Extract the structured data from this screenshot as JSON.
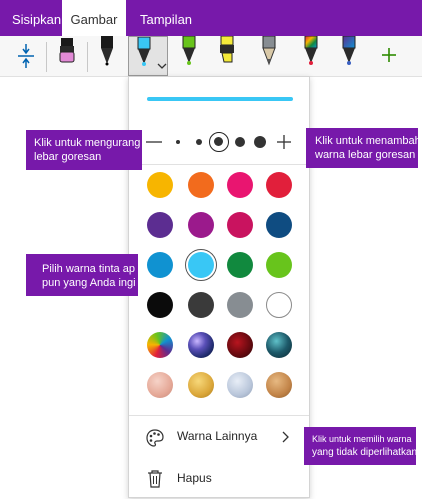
{
  "ribbon": {
    "tabs": [
      {
        "label": "Sisipkan"
      },
      {
        "label": "Gambar"
      },
      {
        "label": "Tampilan"
      }
    ],
    "active_tab": "Gambar"
  },
  "toolbar": {
    "tools": [
      {
        "name": "lasso-space-icon"
      },
      {
        "name": "highlighter-pink-icon"
      },
      {
        "name": "pen-black-icon"
      },
      {
        "name": "pen-cyan-icon",
        "selected": true
      },
      {
        "name": "pen-green-icon"
      },
      {
        "name": "highlighter-yellow-icon"
      },
      {
        "name": "pencil-gray-icon"
      },
      {
        "name": "pen-rainbow-icon"
      },
      {
        "name": "pen-galaxy-icon"
      },
      {
        "name": "add-pen-icon"
      }
    ]
  },
  "panel": {
    "preview_color": "#39c7f5",
    "stroke_widths": {
      "count": 5,
      "selected_index": 2
    },
    "swatches": [
      [
        "#f7b500",
        "#f26b1d",
        "#e91570",
        "#e11f3b"
      ],
      [
        "#5c2d91",
        "#9b1a8c",
        "#c9135f",
        "#0f4c81"
      ],
      [
        "#1092d1",
        "#39c7f5",
        "#11893e",
        "#68c41c"
      ],
      [
        "#0b0b0b",
        "#3a3a3a",
        "#878d92",
        "#ffffff"
      ],
      [
        "rainbow",
        "galaxy",
        "ruby",
        "ocean"
      ],
      [
        "rose-gold",
        "gold",
        "silver",
        "bronze"
      ]
    ],
    "selected_swatch": [
      2,
      1
    ],
    "more_colors_label": "Warna Lainnya",
    "erase_label": "Hapus"
  },
  "callouts": {
    "decrease_width": [
      "Klik untuk mengurang",
      "lebar goresan"
    ],
    "increase_width": [
      "Klik untuk menambah",
      "warna lebar goresan"
    ],
    "ink_color": [
      "Pilih warna tinta ap",
      "pun yang Anda ingi"
    ],
    "more_colors": [
      "Klik untuk memilih warna",
      "yang tidak diperlihatkan"
    ]
  },
  "colors": {
    "accent": "#7719aa",
    "toolbar_bg": "#f7f7f7"
  }
}
